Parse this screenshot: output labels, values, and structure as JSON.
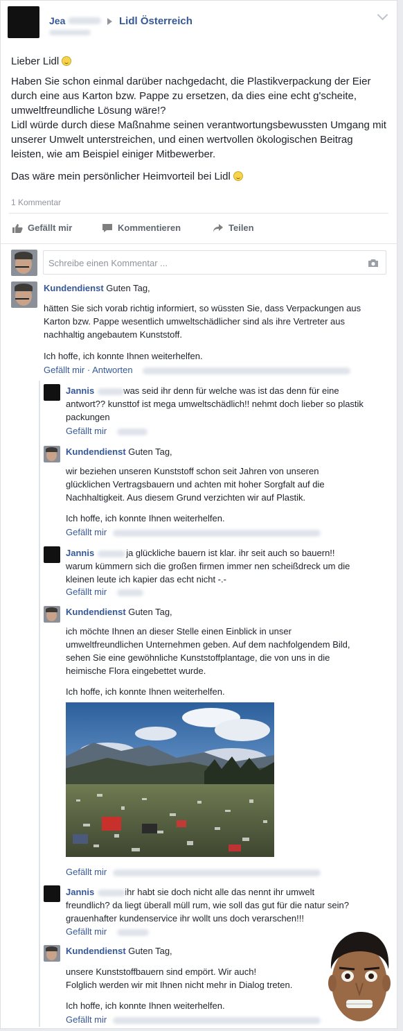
{
  "post": {
    "author_prefix": "Jea",
    "page_name": "Lidl Österreich",
    "greeting": "Lieber Lidl",
    "paragraph1": "Haben Sie schon einmal darüber nachgedacht, die Plastikverpackung der Eier durch eine aus Karton bzw. Pappe zu ersetzen, da dies eine echt g'scheite, umweltfreundliche Lösung wäre!?",
    "paragraph2": "Lidl würde durch diese Maßnahme seinen verantwortungsbewussten Umgang mit unserer Umwelt unterstreichen, und einen wertvollen ökologischen Beitrag leisten, wie am Beispiel einiger Mitbewerber.",
    "closing": "Das wäre mein persönlicher Heimvorteil bei Lidl",
    "comment_count": "1 Kommentar"
  },
  "actions": {
    "like": "Gefällt mir",
    "comment": "Kommentieren",
    "share": "Teilen"
  },
  "comment_box": {
    "placeholder": "Schreibe einen Kommentar ..."
  },
  "comments": [
    {
      "author": "Kundendienst",
      "greeting": "Guten Tag,",
      "body": "hätten Sie sich vorab richtig informiert, so wüssten Sie, dass Verpackungen aus Karton bzw. Pappe wesentlich umweltschädlicher sind als ihre Vertreter aus nachhaltig angebautem Kunststoff.",
      "signoff": "Ich hoffe, ich konnte Ihnen weiterhelfen.",
      "like": "Gefällt mir",
      "reply": "Antworten"
    }
  ],
  "replies": [
    {
      "author": "Jannis",
      "text": "was seid ihr denn für welche was ist das denn für eine antwort?? kunsttof ist mega umweltschädlich!! nehmt doch lieber so plastik packungen",
      "like": "Gefällt mir"
    },
    {
      "author": "Kundendienst",
      "greeting": "Guten Tag,",
      "body": "wir beziehen unseren Kunststoff schon seit Jahren von unseren glücklichen Vertragsbauern und achten mit hoher Sorgfalt auf die Nachhaltigkeit. Aus diesem Grund verzichten wir auf Plastik.",
      "signoff": "Ich hoffe, ich konnte Ihnen weiterhelfen.",
      "like": "Gefällt mir"
    },
    {
      "author": "Jannis",
      "text": "ja glückliche bauern ist klar. ihr seit auch so bauern!! warum kümmern sich die großen firmen immer nen scheißdreck um die kleinen leute ich kapier das echt nicht -.-",
      "like": "Gefällt mir"
    },
    {
      "author": "Kundendienst",
      "greeting": "Guten Tag,",
      "body": "ich möchte Ihnen an dieser Stelle einen Einblick in unser umweltfreundlichen Unternehmen geben. Auf dem nachfolgendem Bild, sehen Sie eine gewöhnliche Kunststoffplantage, die von uns in die heimische Flora eingebettet wurde.",
      "signoff": "Ich hoffe, ich konnte Ihnen weiterhelfen.",
      "like": "Gefällt mir"
    },
    {
      "author": "Jannis",
      "text": "ihr habt sie doch nicht alle das nennt ihr umwelt freundlich? da liegt überall müll rum, wie soll das gut für die natur sein? grauenhafter kundenservice ihr wollt uns doch verarschen!!!",
      "like": "Gefällt mir"
    },
    {
      "author": "Kundendienst",
      "greeting": "Guten Tag,",
      "body1": "unsere Kunststoffbauern sind empört. Wir auch!",
      "body2": "Folglich werden wir mit Ihnen nicht mehr in Dialog treten.",
      "signoff": "Ich hoffe, ich konnte Ihnen weiterhelfen.",
      "like": "Gefällt mir"
    }
  ],
  "icons": {
    "like": "thumbs-up-icon",
    "comment": "speech-bubble-icon",
    "share": "share-arrow-icon",
    "camera": "camera-icon",
    "chevron": "chevron-down-icon",
    "triangle": "triangle-right-icon",
    "smiley": "smiley-emoji-icon"
  },
  "colors": {
    "link": "#365899",
    "text": "#1d2129",
    "muted": "#90949c",
    "background": "#e9ebee"
  }
}
